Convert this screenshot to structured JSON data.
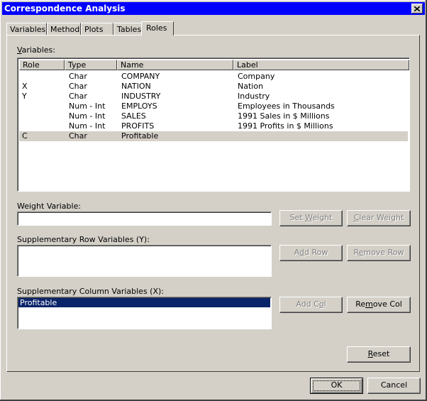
{
  "window": {
    "title": "Correspondence Analysis",
    "close_icon": "close-x-icon"
  },
  "tabs": [
    {
      "label": "Variables",
      "active": false
    },
    {
      "label": "Method",
      "active": false
    },
    {
      "label": "Plots",
      "active": false
    },
    {
      "label": "Tables",
      "active": false
    },
    {
      "label": "Roles",
      "active": true
    }
  ],
  "variables": {
    "label_mnemonic": "V",
    "label_rest": "ariables:",
    "columns": [
      "Role",
      "Type",
      "Name",
      "Label"
    ],
    "rows": [
      {
        "role": "",
        "type": "Char",
        "name": "COMPANY",
        "label": "Company",
        "selected": false
      },
      {
        "role": "X",
        "type": "Char",
        "name": "NATION",
        "label": "Nation",
        "selected": false
      },
      {
        "role": "Y",
        "type": "Char",
        "name": "INDUSTRY",
        "label": "Industry",
        "selected": false
      },
      {
        "role": "",
        "type": "Num - Int",
        "name": "EMPLOYS",
        "label": "Employees in Thousands",
        "selected": false
      },
      {
        "role": "",
        "type": "Num - Int",
        "name": "SALES",
        "label": "1991 Sales in $ Millions",
        "selected": false
      },
      {
        "role": "",
        "type": "Num - Int",
        "name": "PROFITS",
        "label": "1991 Profits in $ Millions",
        "selected": false
      },
      {
        "role": "C",
        "type": "Char",
        "name": "Profitable",
        "label": "",
        "selected": true
      }
    ]
  },
  "weight": {
    "label": "Weight Variable:",
    "value": "",
    "set_pre": "Set ",
    "set_mn": "W",
    "set_post": "eight",
    "clear_pre": "",
    "clear_mn": "C",
    "clear_post": "lear Weight"
  },
  "supp_row": {
    "label": "Supplementary Row Variables (Y):",
    "items": [],
    "add_pre": "A",
    "add_mn": "d",
    "add_post": "d Row",
    "remove_pre": "R",
    "remove_mn": "e",
    "remove_post": "move Row"
  },
  "supp_col": {
    "label": "Supplementary Column Variables (X):",
    "items": [
      {
        "label": "Profitable",
        "selected": true
      }
    ],
    "add_pre": "Add C",
    "add_mn": "o",
    "add_post": "l",
    "remove_pre": "Re",
    "remove_mn": "m",
    "remove_post": "ove Col"
  },
  "reset": {
    "pre": "",
    "mn": "R",
    "post": "eset"
  },
  "footer": {
    "ok": "OK",
    "cancel": "Cancel"
  }
}
